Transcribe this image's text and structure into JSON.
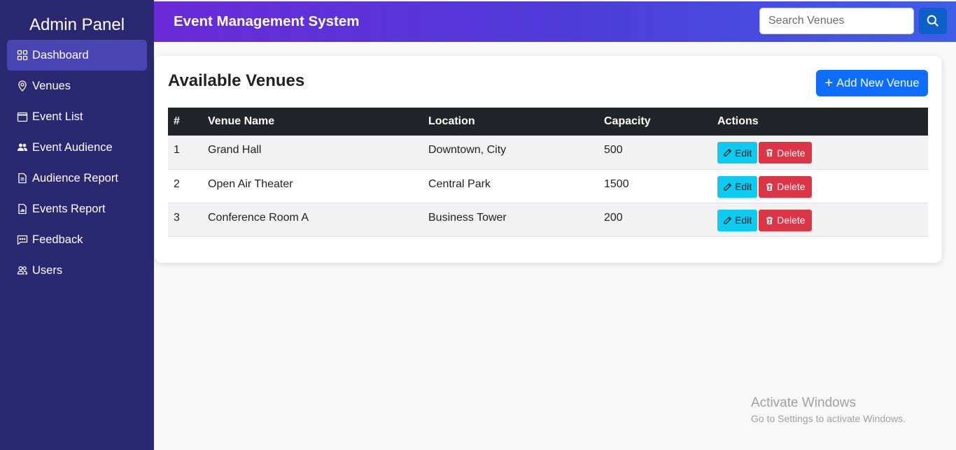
{
  "sidebar": {
    "title": "Admin Panel",
    "items": [
      {
        "label": "Dashboard",
        "icon": "grid-icon",
        "active": true
      },
      {
        "label": "Venues",
        "icon": "map-pin-icon"
      },
      {
        "label": "Event List",
        "icon": "calendar-icon"
      },
      {
        "label": "Event Audience",
        "icon": "people-icon"
      },
      {
        "label": "Audience Report",
        "icon": "document-icon"
      },
      {
        "label": "Events Report",
        "icon": "bar-chart-icon"
      },
      {
        "label": "Feedback",
        "icon": "chat-icon"
      },
      {
        "label": "Users",
        "icon": "users-icon"
      }
    ]
  },
  "header": {
    "title": "Event Management System",
    "search_placeholder": "Search Venues"
  },
  "main": {
    "title": "Available Venues",
    "add_button_label": "Add New Venue",
    "table": {
      "columns": [
        "#",
        "Venue Name",
        "Location",
        "Capacity",
        "Actions"
      ],
      "rows": [
        {
          "num": "1",
          "name": "Grand Hall",
          "location": "Downtown, City",
          "capacity": "500"
        },
        {
          "num": "2",
          "name": "Open Air Theater",
          "location": "Central Park",
          "capacity": "1500"
        },
        {
          "num": "3",
          "name": "Conference Room A",
          "location": "Business Tower",
          "capacity": "200"
        }
      ],
      "edit_label": "Edit",
      "delete_label": "Delete"
    }
  },
  "watermark": {
    "line1": "Activate Windows",
    "line2": "Go to Settings to activate Windows."
  },
  "colors": {
    "sidebar_bg": "#2a2870",
    "active_item": "#4a44b3",
    "header_gradient_start": "#6a2ad8",
    "header_gradient_end": "#3f5ee8",
    "primary": "#0d6efd",
    "edit": "#0dcaf0",
    "delete": "#dc3545",
    "table_header": "#212529"
  }
}
